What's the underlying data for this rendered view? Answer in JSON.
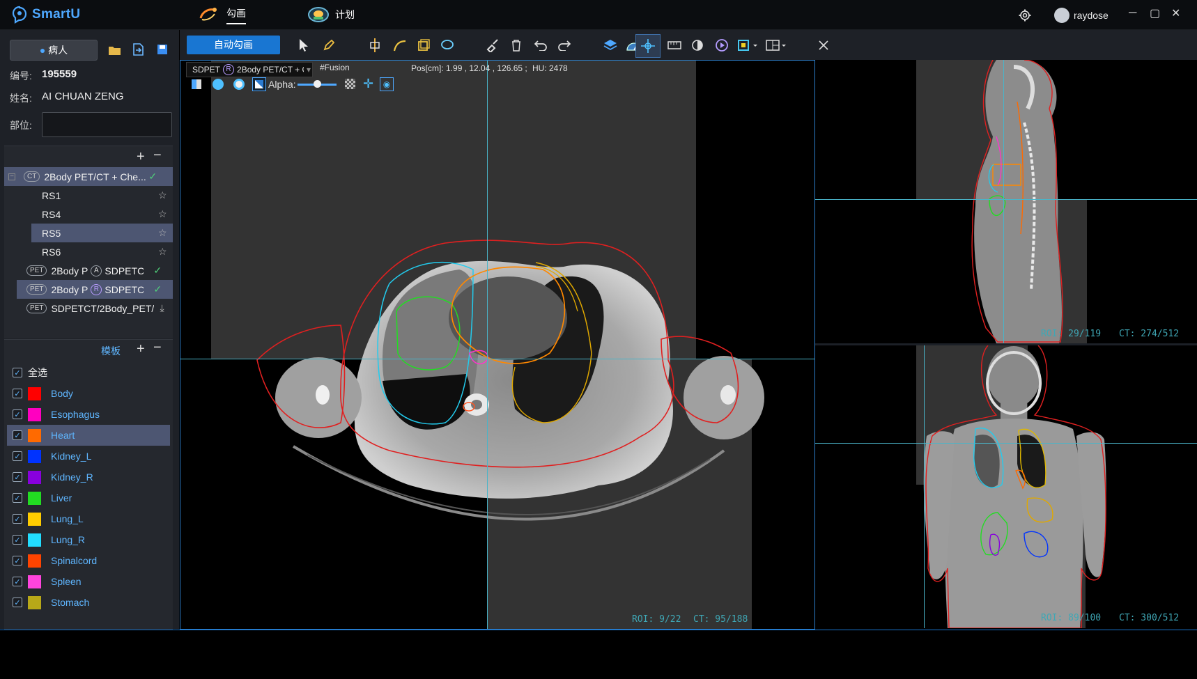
{
  "app": {
    "name": "SmartU"
  },
  "nav": {
    "tab_contour": "勾画",
    "tab_plan": "计划"
  },
  "user": {
    "name": "raydose"
  },
  "left": {
    "patient_button": "病人",
    "id_label": "编号:",
    "id_value": "195559",
    "name_label": "姓名:",
    "name_value": "AI CHUAN ZENG",
    "site_label": "部位:",
    "site_value": "",
    "tree": [
      {
        "badge": "CT",
        "label": "2Body PET/CT + Che...",
        "status": "✓"
      },
      {
        "label": "RS1",
        "status": "☆"
      },
      {
        "label": "RS4",
        "status": "☆"
      },
      {
        "label": "RS5",
        "status": "☆"
      },
      {
        "label": "RS6",
        "status": "☆"
      },
      {
        "badge": "PET",
        "label": "2Body P",
        "rbadge": "A",
        "label2": "SDPETCT",
        "status": "✓"
      },
      {
        "badge": "PET",
        "label": "2Body P",
        "rbadge": "R",
        "label2": "SDPETCT",
        "status": "✓"
      },
      {
        "badge": "PET",
        "label": "SDPETCT/2Body_PET/",
        "status": "⤓"
      }
    ],
    "template_label": "模板",
    "select_all": "全选",
    "rois": [
      {
        "name": "Body",
        "color": "#ff0000"
      },
      {
        "name": "Esophagus",
        "color": "#ff00c0"
      },
      {
        "name": "Heart",
        "color": "#ff6a00"
      },
      {
        "name": "Kidney_L",
        "color": "#0033ff"
      },
      {
        "name": "Kidney_R",
        "color": "#8800dd"
      },
      {
        "name": "Liver",
        "color": "#22dd22"
      },
      {
        "name": "Lung_L",
        "color": "#ffcc00"
      },
      {
        "name": "Lung_R",
        "color": "#22ddff"
      },
      {
        "name": "Spinalcord",
        "color": "#ff4400"
      },
      {
        "name": "Spleen",
        "color": "#ff44dd"
      },
      {
        "name": "Stomach",
        "color": "#b8a818"
      }
    ]
  },
  "toolbar": {
    "auto_contour": "自动勾画"
  },
  "axial": {
    "series": "SDPET",
    "series_badge": "R",
    "series_name": "2Body PET/CT + C",
    "fusion": "#Fusion",
    "pos": "Pos[cm]: 1.99 , 12.04 , 126.65 ;",
    "hu": "HU: 2478",
    "alpha": "Alpha:",
    "alpha_value": 0.5,
    "roi": "ROI: 9/22",
    "ct": "CT: 95/188"
  },
  "sagittal": {
    "roi": "ROI: 29/119",
    "ct": "CT: 274/512"
  },
  "coronal": {
    "roi": "ROI: 89/100",
    "ct": "CT: 300/512"
  }
}
